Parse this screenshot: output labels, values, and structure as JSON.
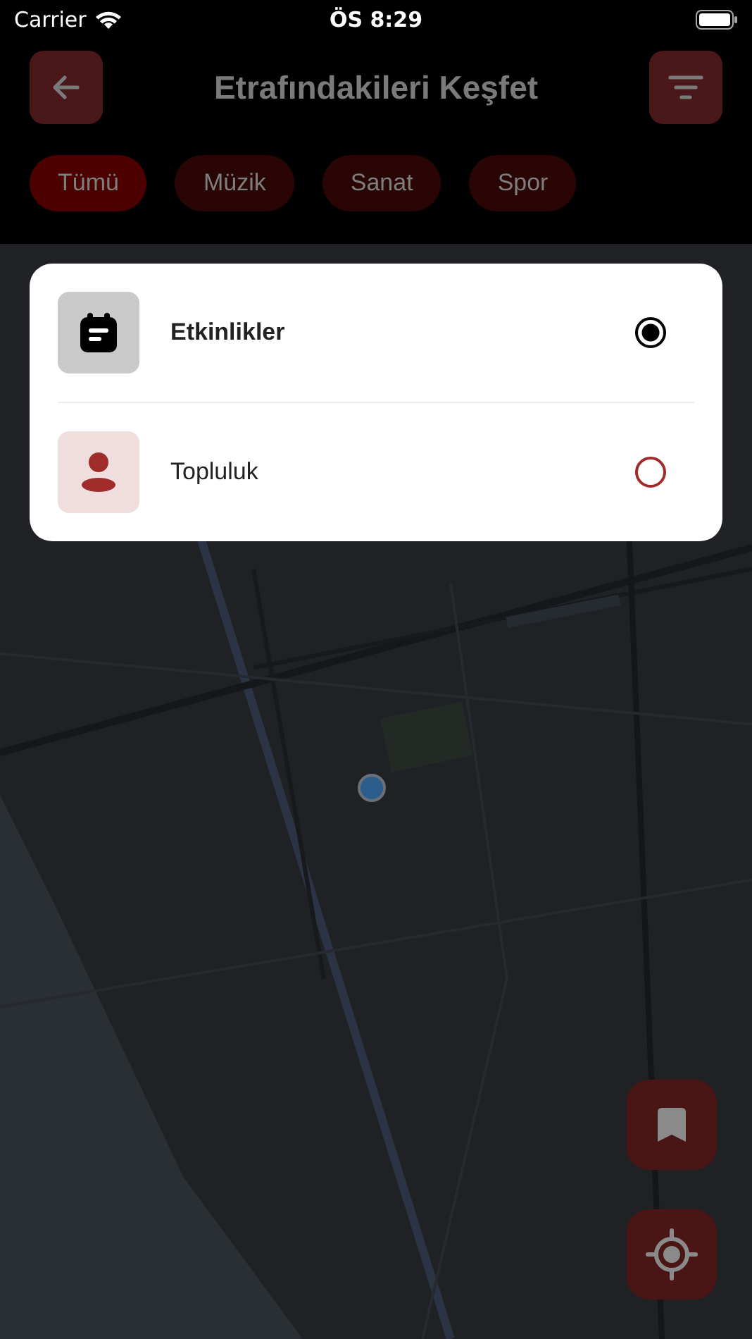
{
  "status_bar": {
    "carrier": "Carrier",
    "time": "ÖS 8:29"
  },
  "header": {
    "title": "Etrafındakileri Keşfet"
  },
  "chips": [
    {
      "label": "Tümü",
      "selected": true
    },
    {
      "label": "Müzik",
      "selected": false
    },
    {
      "label": "Sanat",
      "selected": false
    },
    {
      "label": "Spor",
      "selected": false
    }
  ],
  "layer_menu": {
    "options": [
      {
        "label": "Etkinlikler",
        "selected": true
      },
      {
        "label": "Topluluk",
        "selected": false
      }
    ]
  }
}
